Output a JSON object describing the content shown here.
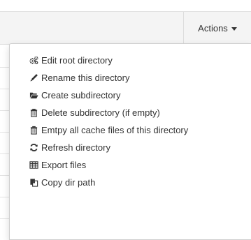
{
  "toolbar": {
    "actions_label": "Actions"
  },
  "menu": {
    "items": [
      {
        "label": "Edit root directory",
        "icon": "gears-icon"
      },
      {
        "label": "Rename this directory",
        "icon": "pencil-icon"
      },
      {
        "label": "Create subdirectory",
        "icon": "folder-open-icon"
      },
      {
        "label": "Delete subdirectory (if empty)",
        "icon": "trash-icon"
      },
      {
        "label": "Emtpy all cache files of this directory",
        "icon": "trash-icon"
      },
      {
        "label": "Refresh directory",
        "icon": "refresh-icon"
      },
      {
        "label": "Export files",
        "icon": "table-icon"
      },
      {
        "label": "Copy dir path",
        "icon": "copy-icon"
      }
    ]
  },
  "colors": {
    "text": "#333333",
    "toolbar_bg": "#f4f4f4",
    "menu_border": "#cfcfcf"
  }
}
